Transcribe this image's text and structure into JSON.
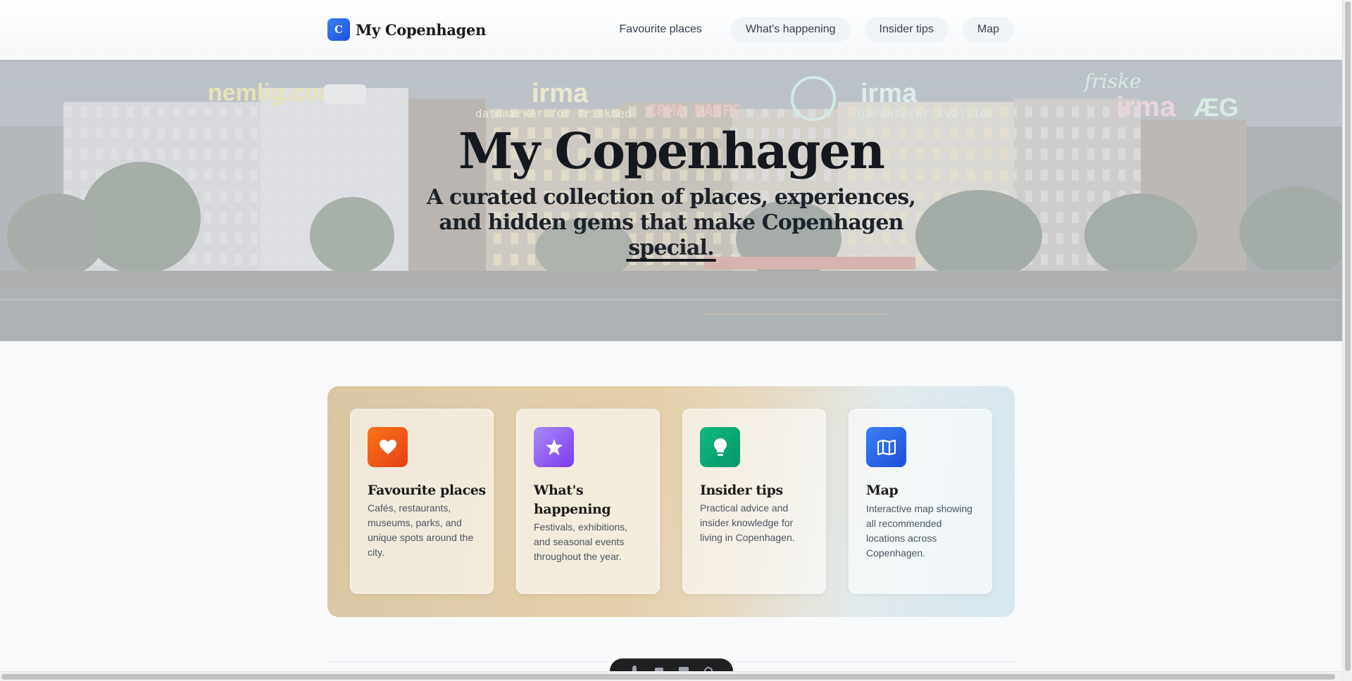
{
  "site": {
    "logo_letter": "C",
    "name": "My Copenhagen"
  },
  "nav": {
    "items": [
      {
        "label": "Favourite places"
      },
      {
        "label": "What's happening"
      },
      {
        "label": "Insider tips"
      },
      {
        "label": "Map"
      }
    ]
  },
  "hero": {
    "title": "My Copenhagen",
    "subtitle": "A curated collection of places, experiences, and hidden gems that make Copenhagen special.",
    "signs": [
      "nemlig.com",
      "irma",
      "datomærker for friskhed",
      "IRMA KAFFE",
      "irma",
      "garanterer kvalitet",
      "friske",
      "irma",
      "ÆG"
    ]
  },
  "cards": [
    {
      "icon": "heart-icon",
      "color": "#f4511e",
      "title": "Favourite places",
      "description": "Cafés, restaurants, museums, parks, and unique spots around the city."
    },
    {
      "icon": "star-icon",
      "color": "#8b5cf6",
      "title": "What's happening",
      "description": "Festivals, exhibitions, and seasonal events throughout the year."
    },
    {
      "icon": "lightbulb-icon",
      "color": "#10a37f",
      "title": "Insider tips",
      "description": "Practical advice and insider knowledge for living in Copenhagen."
    },
    {
      "icon": "map-icon",
      "color": "#2f6fe8",
      "title": "Map",
      "description": "Interactive map showing all recommended locations across Copenhagen."
    }
  ],
  "dock": {
    "icons": [
      "microphone-icon",
      "camera-icon",
      "screen-icon",
      "settings-icon"
    ]
  }
}
